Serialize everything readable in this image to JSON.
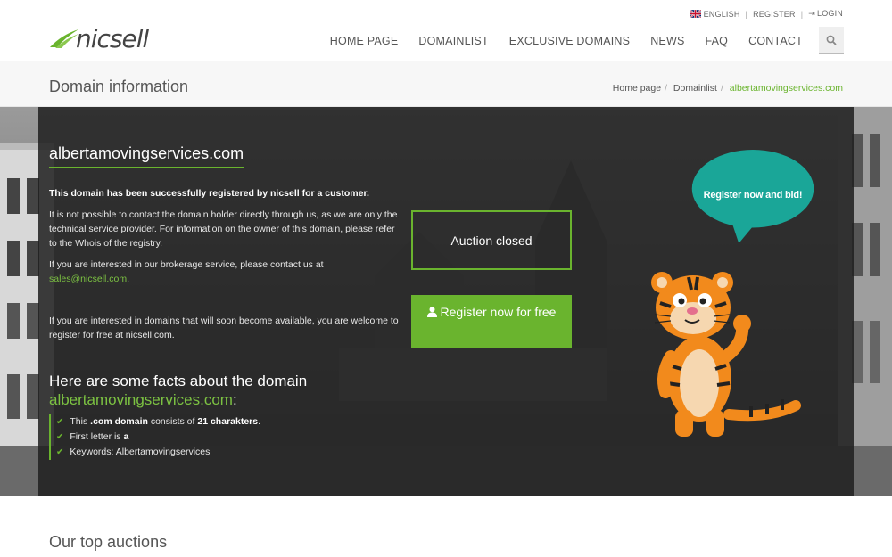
{
  "header": {
    "language_label": "ENGLISH",
    "register_label": "REGISTER",
    "login_label": "LOGIN",
    "logo_text": "nicsell",
    "nav": [
      {
        "label": "HOME PAGE"
      },
      {
        "label": "DOMAINLIST"
      },
      {
        "label": "EXCLUSIVE DOMAINS"
      },
      {
        "label": "NEWS"
      },
      {
        "label": "FAQ"
      },
      {
        "label": "CONTACT"
      }
    ],
    "search_icon": "search-icon"
  },
  "titlebar": {
    "title": "Domain information",
    "breadcrumb": {
      "home": "Home page",
      "list": "Domainlist",
      "current": "albertamovingservices.com"
    }
  },
  "hero": {
    "domain": "albertamovingservices.com",
    "registered_text": "This domain has been successfully registered by nicsell for a customer.",
    "contact_text": "It is not possible to contact the domain holder directly through us, as we are only the technical service provider. For information on the owner of this domain, please refer to the Whois of the registry.",
    "brokerage_text": "If you are interested in our brokerage service, please contact us at",
    "email": "sales@nicsell.com",
    "email_suffix": ".",
    "register_info": "If you are interested in domains that will soon become available, you are welcome to register for free at nicsell.com.",
    "auction_status": "Auction closed",
    "register_button": "Register now for free",
    "facts_title": "Here are some facts about the domain",
    "facts_domain": "albertamovingservices.com",
    "facts_colon": ":",
    "facts": {
      "f1_pre": "This ",
      "f1_bold1": ".com domain",
      "f1_mid": " consists of ",
      "f1_bold2": "21 charakters",
      "f1_end": ".",
      "f2_pre": "First letter is ",
      "f2_bold": "a",
      "f3": "Keywords: Albertamovingservices"
    },
    "bubble_text": "Register now and bid!"
  },
  "bottom": {
    "title": "Our top auctions"
  },
  "colors": {
    "accent": "#6ab42e",
    "bubble": "#1aa698",
    "overlay": "#202020"
  }
}
